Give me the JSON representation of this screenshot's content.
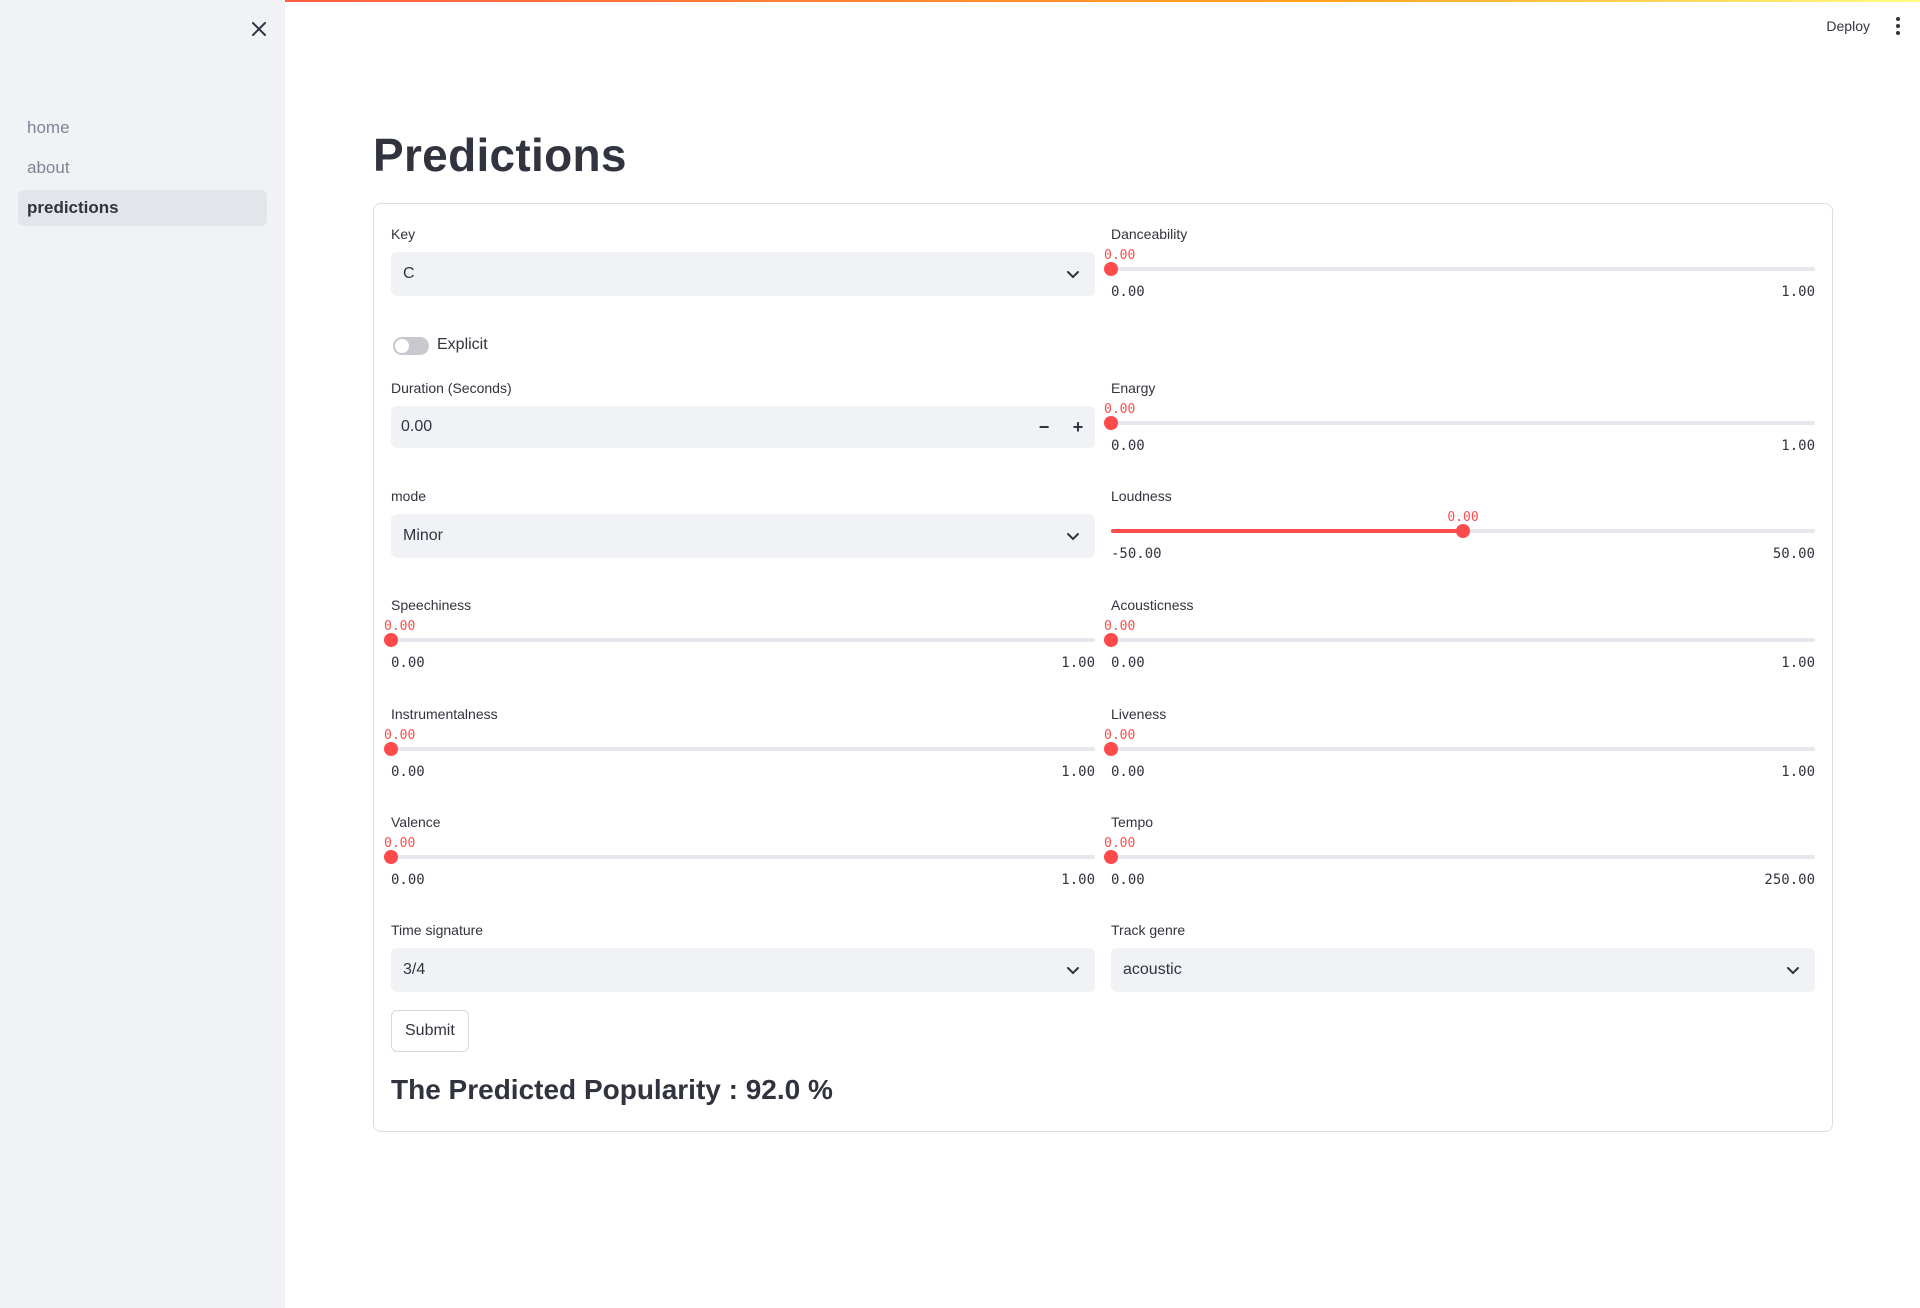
{
  "header": {
    "deploy_label": "Deploy"
  },
  "sidebar": {
    "items": [
      {
        "label": "home",
        "active": false
      },
      {
        "label": "about",
        "active": false
      },
      {
        "label": "predictions",
        "active": true
      }
    ]
  },
  "page": {
    "title": "Predictions"
  },
  "form": {
    "key": {
      "label": "Key",
      "value": "C"
    },
    "explicit": {
      "label": "Explicit",
      "checked": false
    },
    "duration": {
      "label": "Duration (Seconds)",
      "value": "0.00",
      "minus": "−",
      "plus": "+"
    },
    "mode": {
      "label": "mode",
      "value": "Minor"
    },
    "time_signature": {
      "label": "Time signature",
      "value": "3/4"
    },
    "track_genre": {
      "label": "Track genre",
      "value": "acoustic"
    },
    "sliders": {
      "danceability": {
        "label": "Danceability",
        "value": "0.00",
        "min": "0.00",
        "max": "1.00",
        "fraction": 0
      },
      "energy": {
        "label": "Enargy",
        "value": "0.00",
        "min": "0.00",
        "max": "1.00",
        "fraction": 0
      },
      "loudness": {
        "label": "Loudness",
        "value": "0.00",
        "min": "-50.00",
        "max": "50.00",
        "fraction": 0.5
      },
      "speechiness": {
        "label": "Speechiness",
        "value": "0.00",
        "min": "0.00",
        "max": "1.00",
        "fraction": 0
      },
      "acousticness": {
        "label": "Acousticness",
        "value": "0.00",
        "min": "0.00",
        "max": "1.00",
        "fraction": 0
      },
      "instrumentalness": {
        "label": "Instrumentalness",
        "value": "0.00",
        "min": "0.00",
        "max": "1.00",
        "fraction": 0
      },
      "liveness": {
        "label": "Liveness",
        "value": "0.00",
        "min": "0.00",
        "max": "1.00",
        "fraction": 0
      },
      "valence": {
        "label": "Valence",
        "value": "0.00",
        "min": "0.00",
        "max": "1.00",
        "fraction": 0
      },
      "tempo": {
        "label": "Tempo",
        "value": "0.00",
        "min": "0.00",
        "max": "250.00",
        "fraction": 0
      }
    },
    "submit_label": "Submit",
    "result_text": "The Predicted Popularity : 92.0 %"
  },
  "colors": {
    "accent": "#ff4b4b",
    "sidebar_bg": "#f0f2f6",
    "text": "#31333f"
  }
}
